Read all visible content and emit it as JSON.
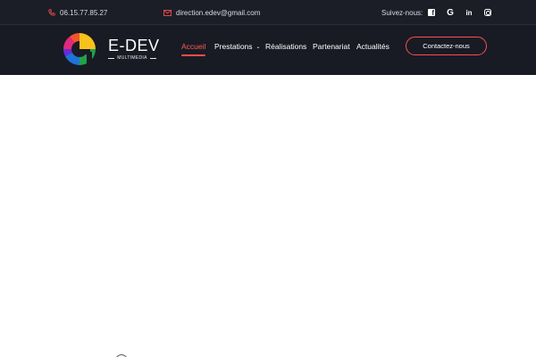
{
  "topbar": {
    "phone": "06.15.77.85.27",
    "email": "direction.edev@gmail.com",
    "follow_label": "Suivez-nous:",
    "socials": [
      {
        "name": "facebook-icon"
      },
      {
        "name": "google-icon"
      },
      {
        "name": "linkedin-icon"
      },
      {
        "name": "instagram-icon"
      }
    ]
  },
  "brand": {
    "name": "E-DEV",
    "tagline": "MULTIMEDIA"
  },
  "nav": {
    "items": [
      {
        "label": "Accueil",
        "active": true
      },
      {
        "label": "Prestations",
        "has_dropdown": true
      },
      {
        "label": "Réalisations"
      },
      {
        "label": "Partenariat"
      },
      {
        "label": "Actualités"
      }
    ],
    "cta_label": "Contactez-nous"
  },
  "colors": {
    "topbar_bg": "#1b1e27",
    "header_bg": "#181b24",
    "accent": "#ff4d4d"
  }
}
